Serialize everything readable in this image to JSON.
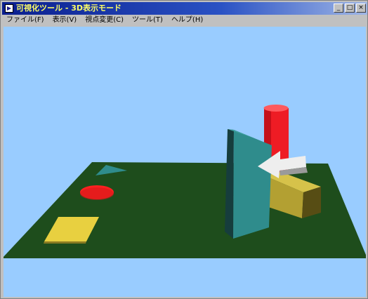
{
  "window": {
    "title": "可視化ツール - 3D表示モード",
    "buttons": {
      "minimize": "_",
      "maximize": "□",
      "close": "×"
    }
  },
  "menu": {
    "items": [
      {
        "label": "ファイル(F)"
      },
      {
        "label": "表示(V)"
      },
      {
        "label": "視点変更(C)"
      },
      {
        "label": "ツール(T)"
      },
      {
        "label": "ヘルプ(H)"
      }
    ]
  },
  "scene": {
    "background_color": "#99ccff",
    "objects": [
      {
        "name": "floor-plane",
        "color": "#1e4d1c"
      },
      {
        "name": "teal-triangle",
        "color": "#2f8c8c"
      },
      {
        "name": "red-disc",
        "color": "#ff2020"
      },
      {
        "name": "yellow-square",
        "color": "#e8d040"
      },
      {
        "name": "red-cylinder",
        "color": "#ee1c24"
      },
      {
        "name": "teal-prism",
        "color": "#2f8c8c"
      },
      {
        "name": "white-arrow",
        "color": "#eeeeee"
      },
      {
        "name": "olive-box",
        "color": "#b3a032"
      }
    ]
  }
}
